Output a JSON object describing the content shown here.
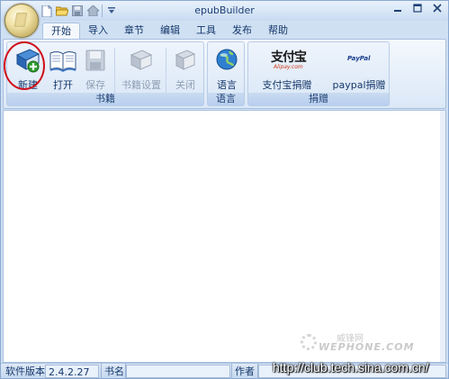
{
  "titlebar": {
    "title": "epubBuilder"
  },
  "tabs": [
    {
      "label": "开始",
      "active": true
    },
    {
      "label": "导入"
    },
    {
      "label": "章节"
    },
    {
      "label": "编辑"
    },
    {
      "label": "工具"
    },
    {
      "label": "发布"
    },
    {
      "label": "帮助"
    }
  ],
  "groups": {
    "books": {
      "label": "书籍",
      "buttons": {
        "new": "新建",
        "open": "打开",
        "save": "保存",
        "settings": "书籍设置",
        "close": "关闭"
      }
    },
    "language": {
      "label": "语言",
      "buttons": {
        "language": "语言"
      }
    },
    "donate": {
      "label": "捐赠",
      "buttons": {
        "alipay": "支付宝捐赠",
        "paypal": "paypal捐赠"
      },
      "alipay_logo_text": "支付宝",
      "alipay_logo_sub": "Alipay.com",
      "paypal_logo_text": "PayPal"
    }
  },
  "statusbar": {
    "version_label": "软件版本",
    "version_value": "2.4.2.27",
    "bookname_label": "书名",
    "author_label": "作者"
  },
  "watermark": {
    "line1": "威锋网",
    "line2": "WEPHONE.COM"
  },
  "overlay_url": "http://club.tech.sina.com.cn/",
  "colors": {
    "accent": "#15386b",
    "ribbon_bg": "#dbe8f7",
    "highlight_circle": "#d0101a"
  }
}
